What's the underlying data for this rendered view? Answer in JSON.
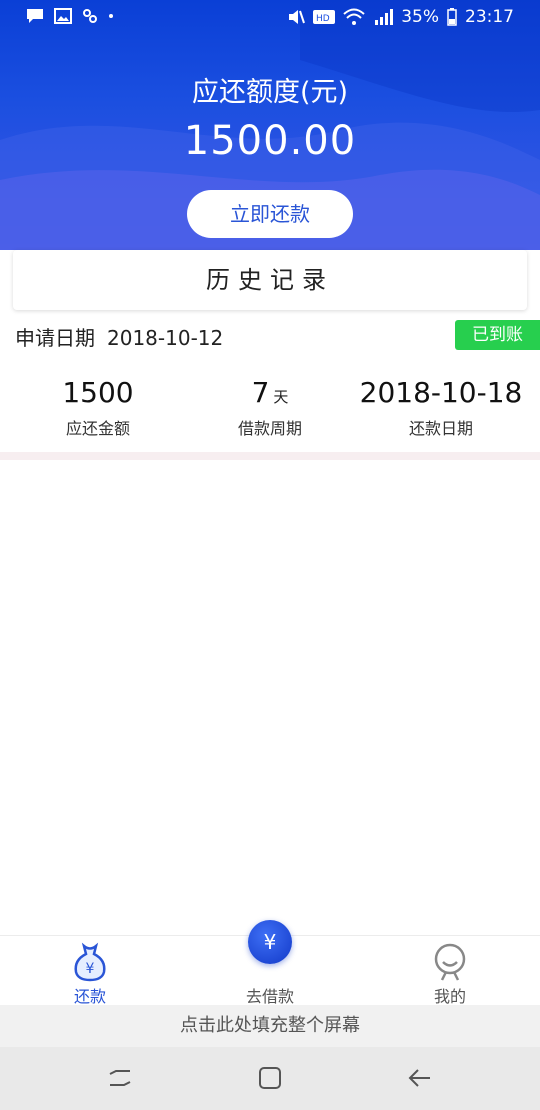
{
  "status_bar": {
    "battery": "35%",
    "time": "23:17",
    "icons": [
      "chat-icon",
      "image-icon",
      "voicemail-icon",
      "dot-icon",
      "mute-icon",
      "hd-icon",
      "wifi-icon",
      "signal-icon",
      "battery-icon"
    ]
  },
  "header": {
    "title": "应还额度(元)",
    "amount": "1500.00",
    "repay_button": "立即还款"
  },
  "history": {
    "title": "历史记录",
    "records": [
      {
        "apply_label": "申请日期",
        "apply_date": "2018-10-12",
        "status": "已到账",
        "amount": "1500",
        "amount_label": "应还金额",
        "period": "7",
        "period_unit": "天",
        "period_label": "借款周期",
        "due_date": "2018-10-18",
        "due_label": "还款日期"
      }
    ]
  },
  "tabbar": {
    "items": [
      {
        "label": "还款",
        "icon": "money-bag-icon",
        "active": true
      },
      {
        "label": "去借款",
        "icon": "yen-icon",
        "active": false
      },
      {
        "label": "我的",
        "icon": "profile-icon",
        "active": false
      }
    ],
    "fab_symbol": "¥"
  },
  "fill_screen_bar": "点击此处填充整个屏幕",
  "colors": {
    "brand_blue": "#1b4fe0",
    "status_green": "#27cf4e",
    "tab_active": "#2a55d6",
    "tab_inactive": "#666666"
  },
  "nav_bar": {
    "icons": [
      "recents-icon",
      "home-icon",
      "back-icon"
    ]
  }
}
